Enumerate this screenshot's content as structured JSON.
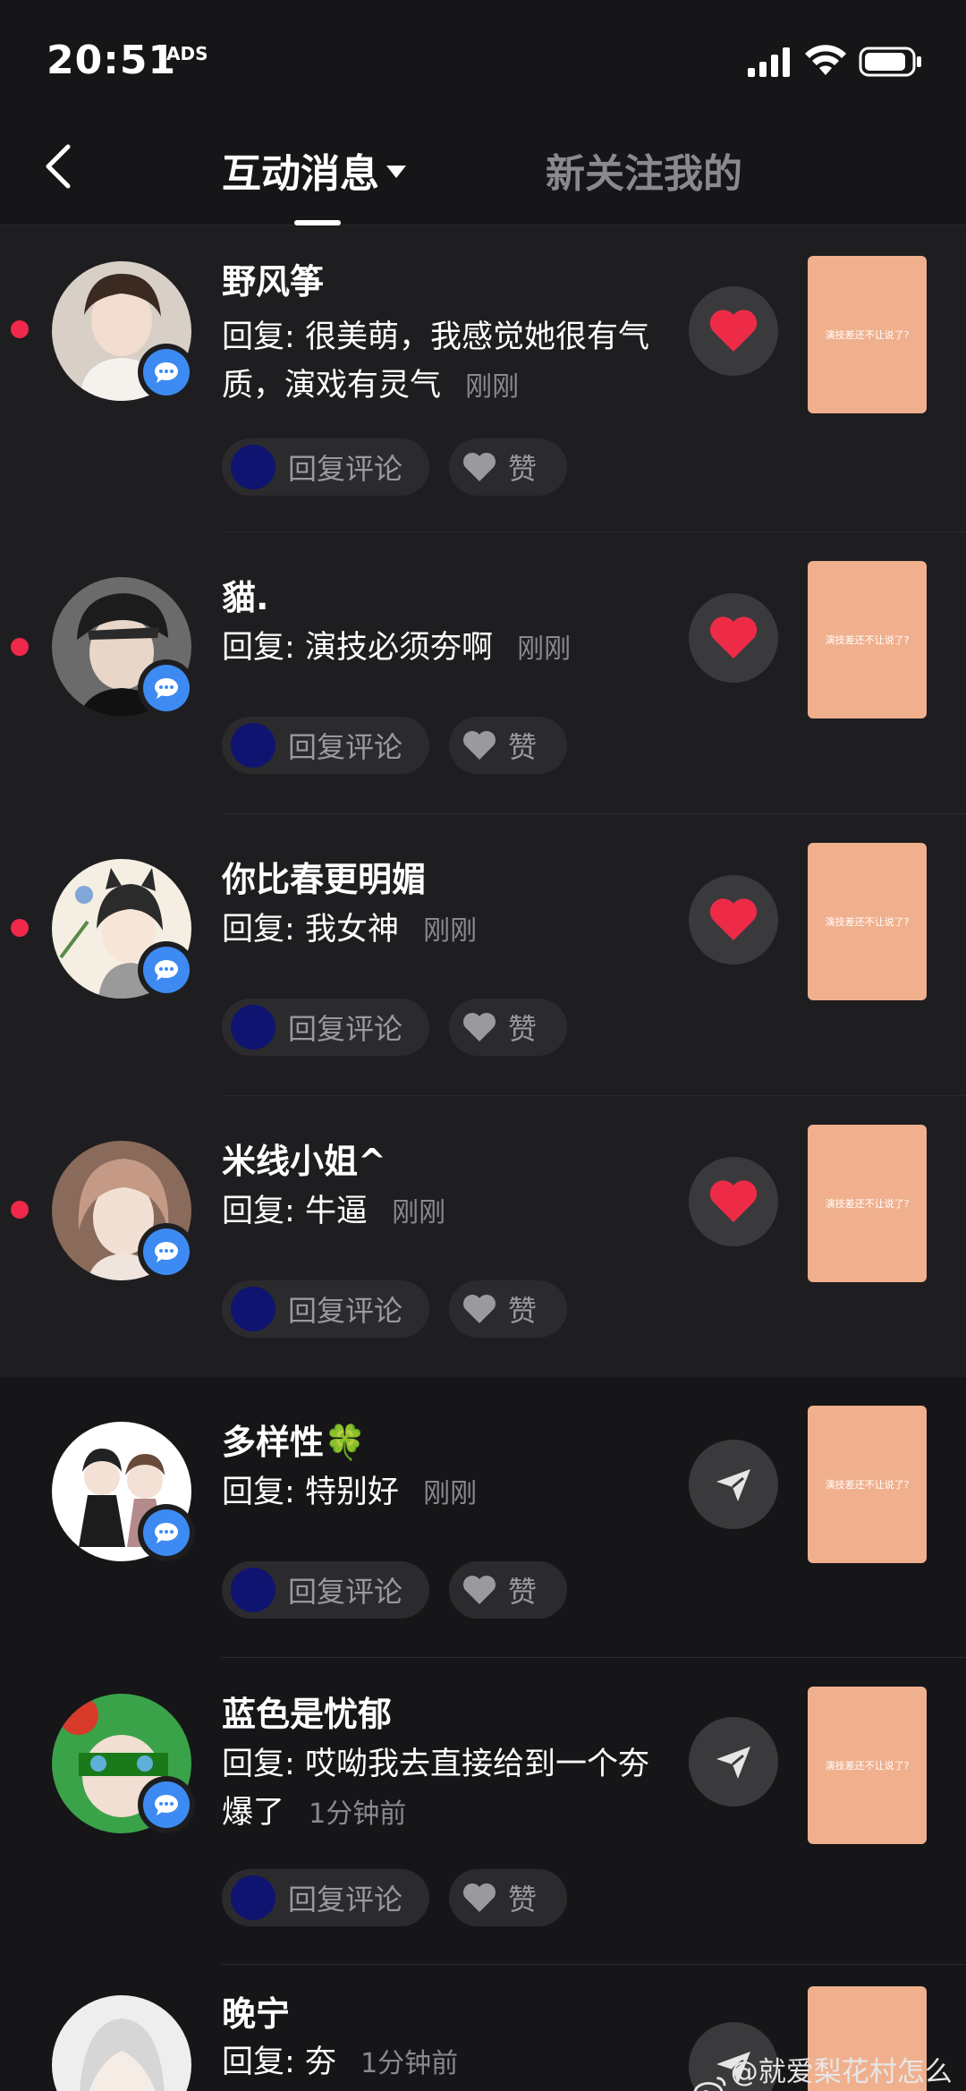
{
  "status_bar": {
    "time": "20:51",
    "extra_indicator": "ADS",
    "signal_icon": "cellular-signal-icon",
    "wifi_icon": "wifi-icon",
    "battery_icon": "battery-icon"
  },
  "header": {
    "back_icon": "chevron-left-icon",
    "tab_active": "互动消息",
    "tab_inactive": "新关注我的"
  },
  "buttons": {
    "reply_comment": "回复评论",
    "like": "赞"
  },
  "colors": {
    "background": "#161618",
    "unread_row": "#1e1e21",
    "unread_dot": "#f0284a",
    "comment_badge": "#3d8bf2",
    "heart": "#ee2b47",
    "thumbnail": "#f0b08e"
  },
  "notifications": [
    {
      "username": "野风筝",
      "reply_prefix": "回复:",
      "reply_text": "很美萌，我感觉她很有气质，演戏有灵气",
      "timestamp": "刚刚",
      "unread": true,
      "action_icon": "heart-icon",
      "thumbnail_text": "演技差还不让说了?"
    },
    {
      "username": "貓.",
      "reply_prefix": "回复:",
      "reply_text": "演技必须夯啊",
      "timestamp": "刚刚",
      "unread": true,
      "action_icon": "heart-icon",
      "thumbnail_text": "演技差还不让说了?"
    },
    {
      "username": "你比春更明媚",
      "reply_prefix": "回复:",
      "reply_text": "我女神",
      "timestamp": "刚刚",
      "unread": true,
      "action_icon": "heart-icon",
      "thumbnail_text": "演技差还不让说了?"
    },
    {
      "username": "米线小姐^",
      "reply_prefix": "回复:",
      "reply_text": "牛逼",
      "timestamp": "刚刚",
      "unread": true,
      "action_icon": "heart-icon",
      "thumbnail_text": "演技差还不让说了?"
    },
    {
      "username": "多样性🍀",
      "reply_prefix": "回复:",
      "reply_text": "特别好",
      "timestamp": "刚刚",
      "unread": false,
      "action_icon": "send-icon",
      "thumbnail_text": "演技差还不让说了?"
    },
    {
      "username": "蓝色是忧郁",
      "reply_prefix": "回复:",
      "reply_text": "哎呦我去直接给到一个夯爆了",
      "timestamp": "1分钟前",
      "unread": false,
      "action_icon": "send-icon",
      "thumbnail_text": "演技差还不让说了?"
    },
    {
      "username": "晚宁",
      "reply_prefix": "回复:",
      "reply_text": "夯",
      "timestamp": "1分钟前",
      "unread": false,
      "action_icon": "send-icon",
      "thumbnail_text": ""
    }
  ],
  "watermark": {
    "icon": "weibo-icon",
    "text": "@就爱梨花村怎么滴"
  }
}
